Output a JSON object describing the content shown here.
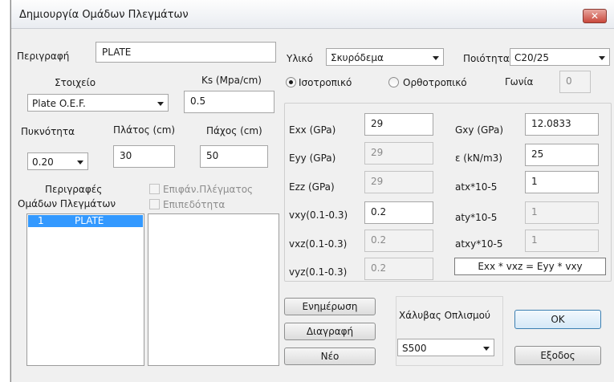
{
  "window": {
    "title": "Δημιουργία Ομάδων Πλεγμάτων",
    "close_glyph": "✕"
  },
  "left": {
    "description_label": "Περιγραφή",
    "description_value": "PLATE",
    "element_label": "Στοιχείο",
    "element_value": "Plate O.E.F.",
    "ks_label": "Ks (Mpa/cm)",
    "ks_value": "0.5",
    "density_label": "Πυκνότητα",
    "density_value": "0.20",
    "width_label": "Πλάτος (cm)",
    "width_value": "30",
    "thickness_label": "Πάχος (cm)",
    "thickness_value": "50",
    "groups_label_1": "Περιγραφές",
    "groups_label_2": "Ομάδων Πλεγμάτων",
    "surface_checkbox_label": "Επιφάν.Πλέγματος",
    "planarity_checkbox_label": "Επιπεδότητα",
    "groups": [
      {
        "index": "1",
        "name": "PLATE"
      }
    ]
  },
  "material": {
    "label": "Υλικό",
    "value": "Σκυρόδεμα",
    "quality_label": "Ποιότητα",
    "quality_value": "C20/25",
    "isotropic_label": "Ισοτροπικό",
    "orthotropic_label": "Ορθοτροπικό",
    "angle_label": "Γωνία",
    "angle_value": "0",
    "fields": {
      "exx_label": "Exx (GPa)",
      "exx_value": "29",
      "eyy_label": "Eyy (GPa)",
      "eyy_value": "29",
      "ezz_label": "Ezz (GPa)",
      "ezz_value": "29",
      "vxy_label": "vxy(0.1-0.3)",
      "vxy_value": "0.2",
      "vxz_label": "vxz(0.1-0.3)",
      "vxz_value": "0.2",
      "vyz_label": "vyz(0.1-0.3)",
      "vyz_value": "0.2",
      "gxy_label": "Gxy (GPa)",
      "gxy_value": "12.0833",
      "eps_label": "ε (kN/m3)",
      "eps_value": "25",
      "atx_label": "atx*10-5",
      "atx_value": "1",
      "aty_label": "aty*10-5",
      "aty_value": "1",
      "atxy_label": "atxy*10-5",
      "atxy_value": "1"
    },
    "formula": "Exx * vxz = Eyy * vxy"
  },
  "buttons": {
    "update": "Ενημέρωση",
    "delete": "Διαγραφή",
    "new": "Νέο",
    "ok": "OK",
    "exit": "Εξοδος"
  },
  "steel": {
    "label": "Χάλυβας Οπλισμού",
    "value": "S500"
  }
}
